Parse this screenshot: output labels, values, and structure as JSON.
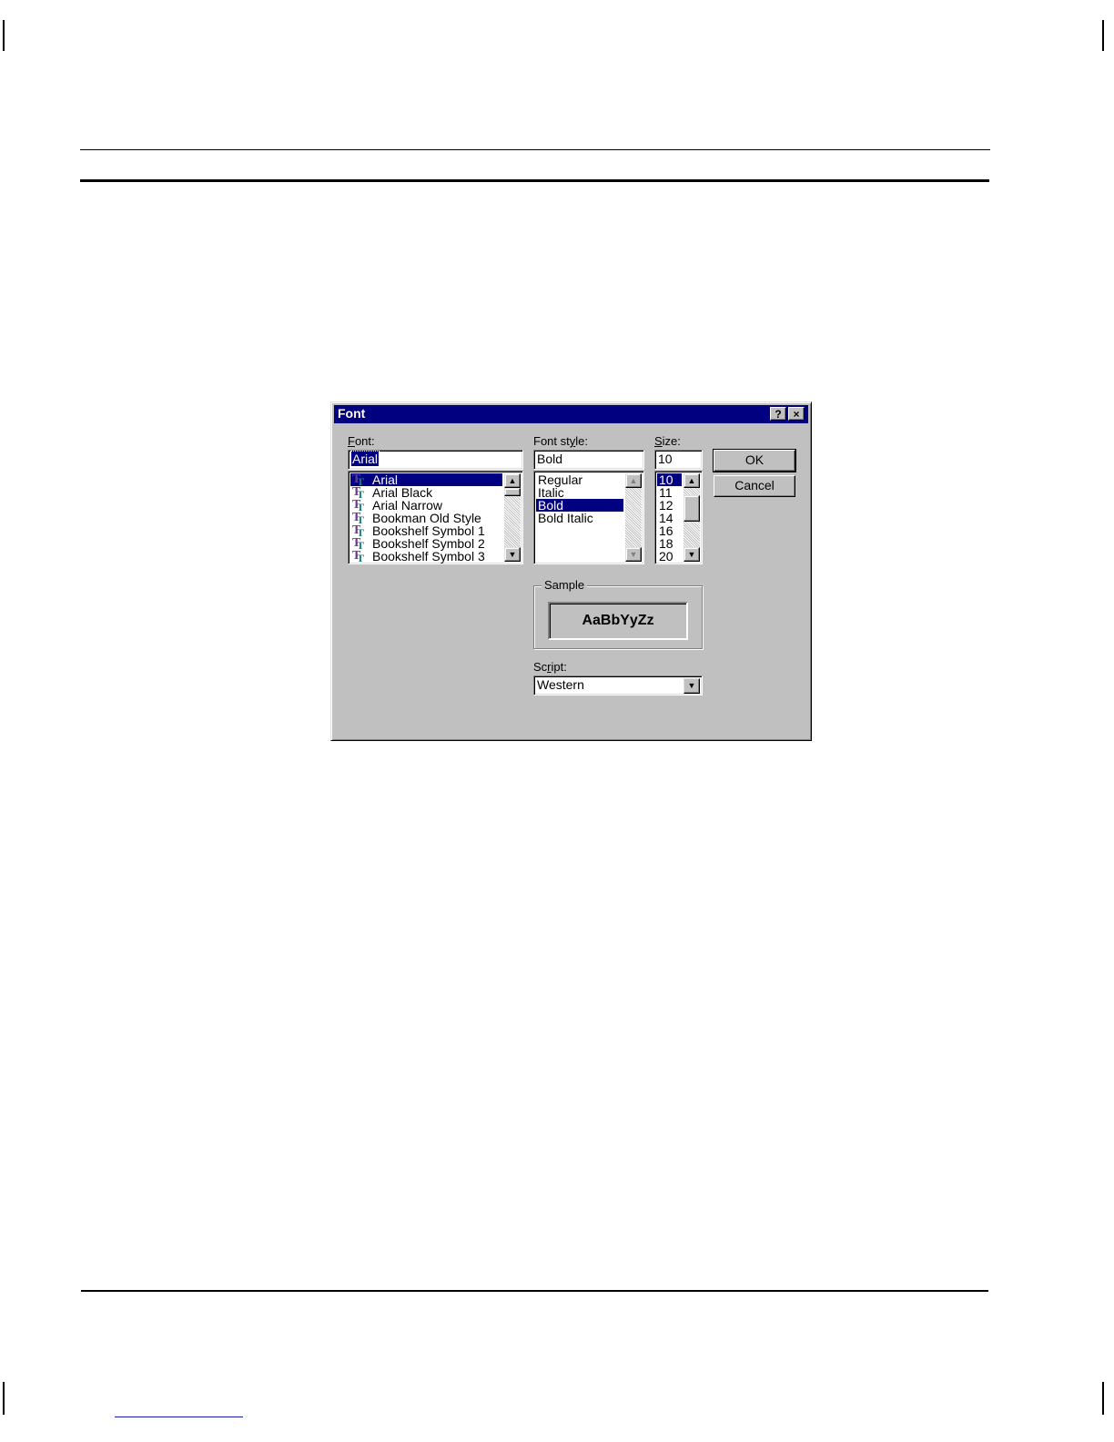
{
  "dialog": {
    "title": "Font",
    "help_button": "?",
    "close_button": "×",
    "font_label": {
      "accel": "F",
      "rest": "ont:"
    },
    "font_style_label": {
      "pre": "Font st",
      "accel": "y",
      "rest": "le:"
    },
    "size_label": {
      "accel": "S",
      "rest": "ize:"
    },
    "font_value": "Arial",
    "font_style_value": "Bold",
    "size_value": "10",
    "fonts": [
      {
        "name": "Arial",
        "selected": true
      },
      {
        "name": "Arial Black",
        "selected": false
      },
      {
        "name": "Arial Narrow",
        "selected": false
      },
      {
        "name": "Bookman Old Style",
        "selected": false
      },
      {
        "name": "Bookshelf Symbol 1",
        "selected": false
      },
      {
        "name": "Bookshelf Symbol 2",
        "selected": false
      },
      {
        "name": "Bookshelf Symbol 3",
        "selected": false
      }
    ],
    "font_styles": [
      {
        "name": "Regular",
        "selected": false
      },
      {
        "name": "Italic",
        "selected": false
      },
      {
        "name": "Bold",
        "selected": true
      },
      {
        "name": "Bold Italic",
        "selected": false
      }
    ],
    "sizes": [
      {
        "name": "10",
        "selected": true
      },
      {
        "name": "11",
        "selected": false
      },
      {
        "name": "12",
        "selected": false
      },
      {
        "name": "14",
        "selected": false
      },
      {
        "name": "16",
        "selected": false
      },
      {
        "name": "18",
        "selected": false
      },
      {
        "name": "20",
        "selected": false
      }
    ],
    "ok_label": "OK",
    "cancel_label": "Cancel",
    "sample_label": "Sample",
    "sample_text": "AaBbYyZz",
    "script_label": {
      "pre": "Sc",
      "accel": "r",
      "rest": "ipt:"
    },
    "script_value": "Western",
    "truetype_icon": "truetype-font-icon",
    "colors": {
      "titlebar": "#000080",
      "face": "#c0c0c0",
      "selection": "#000080"
    }
  }
}
